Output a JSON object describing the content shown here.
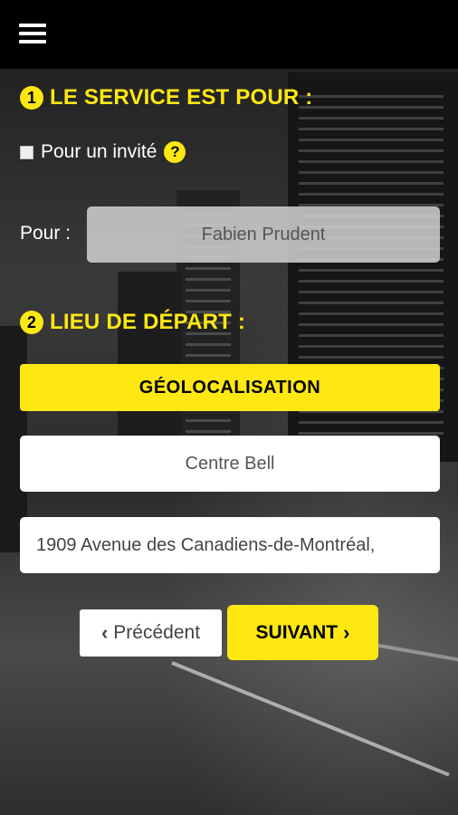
{
  "section1": {
    "number": "1",
    "title": "LE SERVICE EST POUR :"
  },
  "guest": {
    "label": "Pour un invité",
    "help_symbol": "?"
  },
  "pour": {
    "label": "Pour :",
    "value": "Fabien Prudent"
  },
  "section2": {
    "number": "2",
    "title": "LIEU DE DÉPART :"
  },
  "geo_button": {
    "label": "GÉOLOCALISATION"
  },
  "place_name": {
    "value": "Centre Bell"
  },
  "address": {
    "value": "1909 Avenue des Canadiens-de-Montréal,"
  },
  "nav": {
    "prev_label": "Précédent",
    "prev_icon": "‹",
    "next_label": "SUIVANT",
    "next_icon": "›"
  },
  "colors": {
    "accent": "#ffe812",
    "topbar": "#000000"
  }
}
